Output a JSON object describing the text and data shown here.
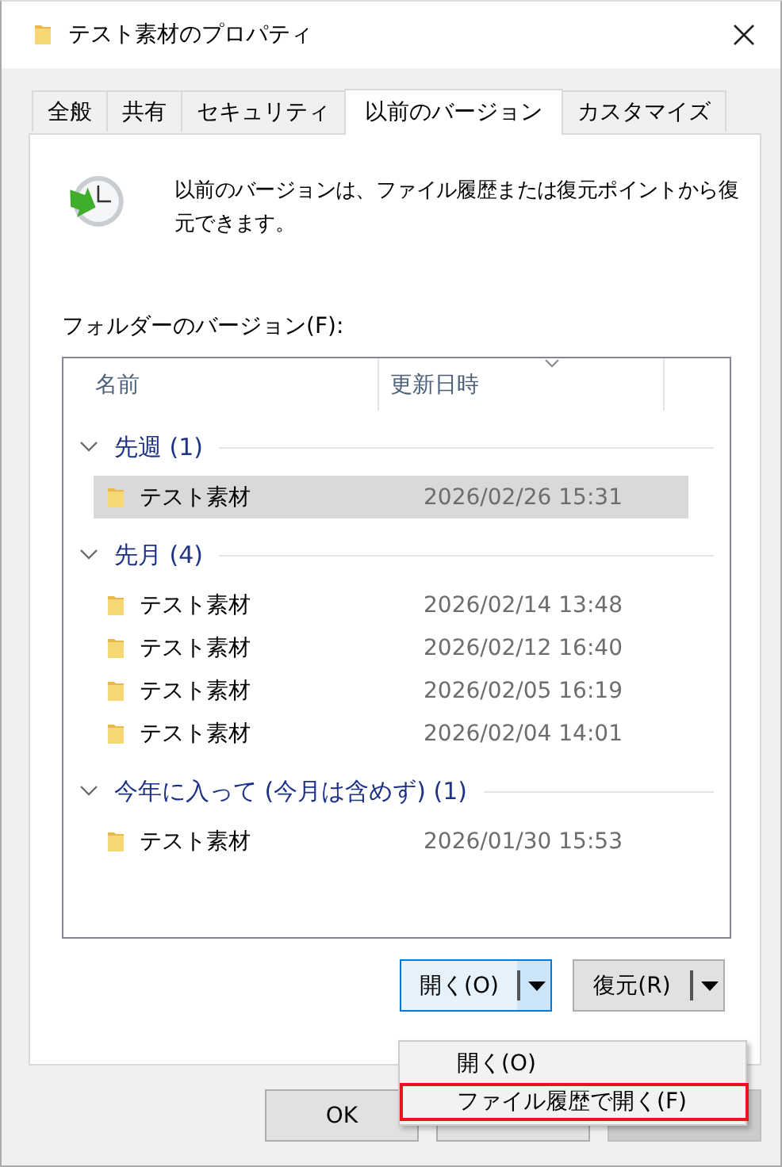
{
  "window": {
    "title": "テスト素材のプロパティ"
  },
  "tabs": [
    {
      "label": "全般",
      "selected": false
    },
    {
      "label": "共有",
      "selected": false
    },
    {
      "label": "セキュリティ",
      "selected": false
    },
    {
      "label": "以前のバージョン",
      "selected": true
    },
    {
      "label": "カスタマイズ",
      "selected": false
    }
  ],
  "description": "以前のバージョンは、ファイル履歴または復元ポイントから復元できます。",
  "list_label": "フォルダーのバージョン(F):",
  "columns": [
    "名前",
    "更新日時"
  ],
  "groups": [
    {
      "label": "先週 (1)",
      "expanded": true,
      "rows": [
        {
          "name": "テスト素材",
          "date": "2026/02/26 15:31",
          "selected": true
        }
      ]
    },
    {
      "label": "先月 (4)",
      "expanded": true,
      "rows": [
        {
          "name": "テスト素材",
          "date": "2026/02/14 13:48",
          "selected": false
        },
        {
          "name": "テスト素材",
          "date": "2026/02/12 16:40",
          "selected": false
        },
        {
          "name": "テスト素材",
          "date": "2026/02/05 16:19",
          "selected": false
        },
        {
          "name": "テスト素材",
          "date": "2026/02/04 14:01",
          "selected": false
        }
      ]
    },
    {
      "label": "今年に入って (今月は含めず) (1)",
      "expanded": true,
      "rows": [
        {
          "name": "テスト素材",
          "date": "2026/01/30 15:53",
          "selected": false
        }
      ]
    }
  ],
  "action_buttons": [
    {
      "label": "開く(O)",
      "focused": true
    },
    {
      "label": "復元(R)",
      "focused": false
    }
  ],
  "menu": [
    {
      "label": "開く(O)",
      "highlighted": false
    },
    {
      "label": "ファイル履歴で開く(F)",
      "highlighted": true
    }
  ],
  "dialog_buttons": [
    {
      "label": "OK",
      "disabled": false
    },
    {
      "disabled": false
    },
    {
      "disabled": true
    }
  ]
}
